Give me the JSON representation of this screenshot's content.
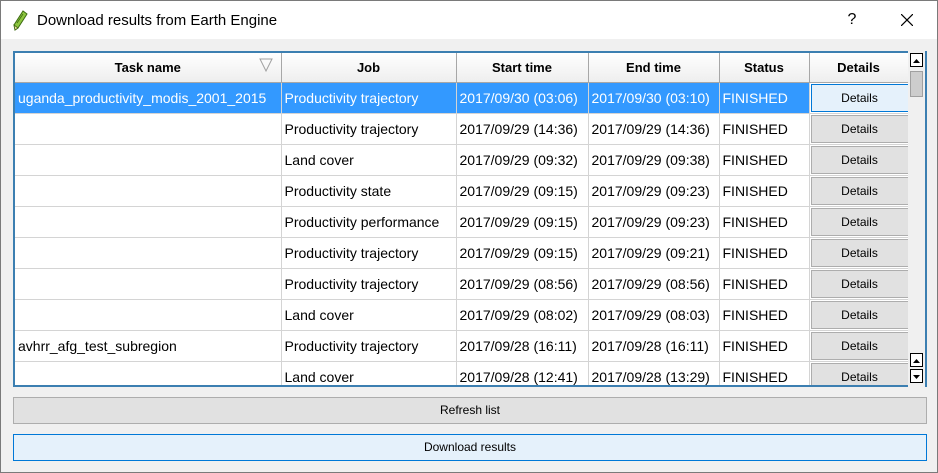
{
  "window": {
    "title": "Download results from Earth Engine",
    "help_label": "?"
  },
  "table": {
    "headers": [
      "Task name",
      "Job",
      "Start time",
      "End time",
      "Status",
      "Details"
    ],
    "rows": [
      {
        "task": "uganda_productivity_modis_2001_2015",
        "job": "Productivity trajectory",
        "start": "2017/09/30 (03:06)",
        "end": "2017/09/30 (03:10)",
        "status": "FINISHED",
        "details": "Details",
        "selected": true
      },
      {
        "task": "",
        "job": "Productivity trajectory",
        "start": "2017/09/29 (14:36)",
        "end": "2017/09/29 (14:36)",
        "status": "FINISHED",
        "details": "Details"
      },
      {
        "task": "",
        "job": "Land cover",
        "start": "2017/09/29 (09:32)",
        "end": "2017/09/29 (09:38)",
        "status": "FINISHED",
        "details": "Details"
      },
      {
        "task": "",
        "job": "Productivity state",
        "start": "2017/09/29 (09:15)",
        "end": "2017/09/29 (09:23)",
        "status": "FINISHED",
        "details": "Details"
      },
      {
        "task": "",
        "job": "Productivity performance",
        "start": "2017/09/29 (09:15)",
        "end": "2017/09/29 (09:23)",
        "status": "FINISHED",
        "details": "Details"
      },
      {
        "task": "",
        "job": "Productivity trajectory",
        "start": "2017/09/29 (09:15)",
        "end": "2017/09/29 (09:21)",
        "status": "FINISHED",
        "details": "Details"
      },
      {
        "task": "",
        "job": "Productivity trajectory",
        "start": "2017/09/29 (08:56)",
        "end": "2017/09/29 (08:56)",
        "status": "FINISHED",
        "details": "Details"
      },
      {
        "task": "",
        "job": "Land cover",
        "start": "2017/09/29 (08:02)",
        "end": "2017/09/29 (08:03)",
        "status": "FINISHED",
        "details": "Details"
      },
      {
        "task": "avhrr_afg_test_subregion",
        "job": "Productivity trajectory",
        "start": "2017/09/28 (16:11)",
        "end": "2017/09/28 (16:11)",
        "status": "FINISHED",
        "details": "Details"
      },
      {
        "task": "",
        "job": "Land cover",
        "start": "2017/09/28 (12:41)",
        "end": "2017/09/28 (13:29)",
        "status": "FINISHED",
        "details": "Details"
      }
    ]
  },
  "buttons": {
    "refresh": "Refresh list",
    "download": "Download results"
  },
  "colors": {
    "selection": "#3399ff",
    "frame_accent": "#3c7fb1"
  },
  "icons": {
    "app": "qgis-pencil-icon",
    "close": "close-icon",
    "sort": "sort-indicator-icon",
    "scroll_up": "scroll-up-arrow-icon",
    "scroll_down": "scroll-down-arrow-icon"
  }
}
